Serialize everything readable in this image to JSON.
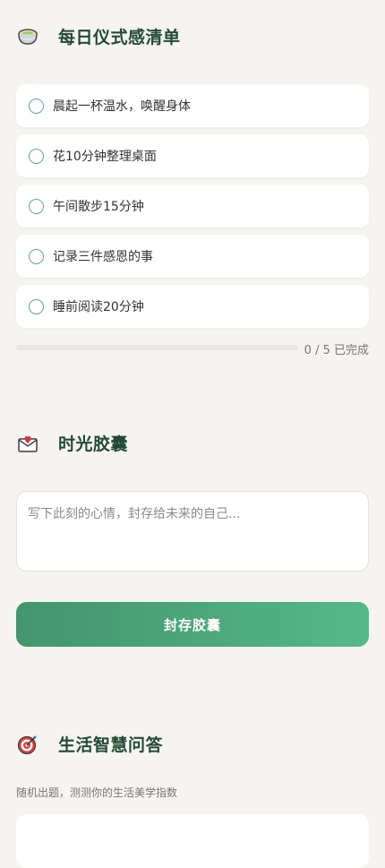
{
  "checklist": {
    "icon": "bowl-icon",
    "title": "每日仪式感清单",
    "items": [
      {
        "label": "晨起一杯温水，唤醒身体"
      },
      {
        "label": "花10分钟整理桌面"
      },
      {
        "label": "午间散步15分钟"
      },
      {
        "label": "记录三件感恩的事"
      },
      {
        "label": "睡前阅读20分钟"
      }
    ],
    "progress": {
      "completed": 0,
      "total": 5,
      "text": "0 / 5 已完成"
    }
  },
  "capsule": {
    "icon": "love-letter-icon",
    "title": "时光胶囊",
    "placeholder": "写下此刻的心情，封存给未来的自己...",
    "button_label": "封存胶囊"
  },
  "quiz": {
    "icon": "target-icon",
    "title": "生活智慧问答",
    "subtitle": "随机出题，测测你的生活美学指数"
  },
  "colors": {
    "accent": "#57b08a",
    "title": "#234a36",
    "background": "#f6f4f0"
  }
}
